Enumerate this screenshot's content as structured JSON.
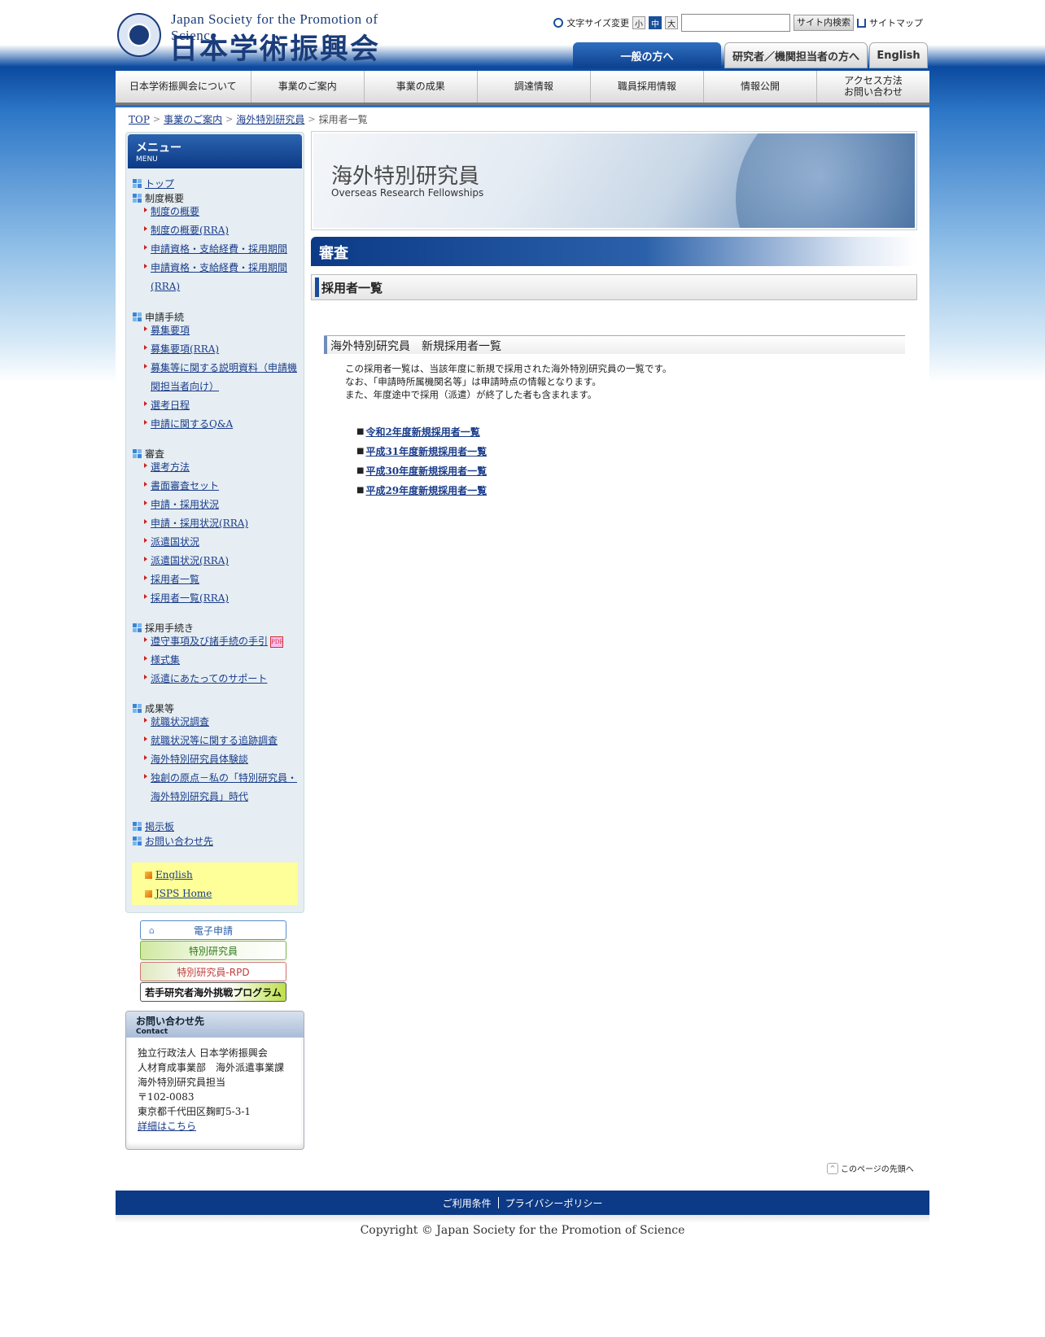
{
  "header": {
    "logo_en": "Japan Society for the Promotion of Science",
    "logo_jp": "日本学術振興会",
    "font_size_label": "文字サイズ変更",
    "font_sizes": [
      "小",
      "中",
      "大"
    ],
    "search_placeholder": "",
    "search_button": "サイト内検索",
    "sitemap": "サイトマップ",
    "tabs": [
      "一般の方へ",
      "研究者／機関担当者の方へ",
      "English"
    ]
  },
  "gnav": [
    "日本学術振興会について",
    "事業のご案内",
    "事業の成果",
    "調達情報",
    "職員採用情報",
    "情報公開",
    "アクセス方法\nお問い合わせ"
  ],
  "breadcrumb": [
    "TOP",
    "事業のご案内",
    "海外特別研究員",
    "採用者一覧"
  ],
  "sidebar": {
    "title": "メニュー",
    "title_en": "MENU",
    "top": "トップ",
    "sec1": "制度概要",
    "sec1_items": [
      "制度の概要",
      "制度の概要(RRA)",
      "申請資格・支給経費・採用期間",
      "申請資格・支給経費・採用期間(RRA)"
    ],
    "sec2": "申請手続",
    "sec2_items": [
      "募集要項",
      "募集要項(RRA)",
      "募集等に関する説明資料（申請機関担当者向け）",
      "選考日程",
      "申請に関するQ&A"
    ],
    "sec3": "審査",
    "sec3_items": [
      "選考方法",
      "書面審査セット",
      "申請・採用状況",
      "申請・採用状況(RRA)",
      "派遣国状況",
      "派遣国状況(RRA)",
      "採用者一覧",
      "採用者一覧(RRA)"
    ],
    "sec4": "採用手続き",
    "sec4_items": [
      "遵守事項及び諸手続の手引",
      "様式集",
      "派遣にあたってのサポート"
    ],
    "sec5": "成果等",
    "sec5_items": [
      "就職状況調査",
      "就職状況等に関する追跡調査",
      "海外特別研究員体験談",
      "独創の原点－私の「特別研究員・海外特別研究員」時代"
    ],
    "bbs": "掲示板",
    "contact": "お問い合わせ先",
    "links": [
      "English",
      "JSPS Home"
    ]
  },
  "banners": [
    "電子申請",
    "特別研究員",
    "特別研究員-RPD",
    "若手研究者海外挑戦プログラム"
  ],
  "contact": {
    "title": "お問い合わせ先",
    "title_en": "Contact",
    "lines": [
      "独立行政法人 日本学術振興会",
      "人材育成事業部　海外派遣事業課",
      "海外特別研究員担当",
      "〒102-0083",
      "東京都千代田区麹町5-3-1"
    ],
    "detail": "詳細はこちら"
  },
  "main": {
    "hero_jp": "海外特別研究員",
    "hero_en": "Overseas Research Fellowships",
    "h2": "審査",
    "h3": "採用者一覧",
    "h4": "海外特別研究員　新規採用者一覧",
    "desc": [
      "この採用者一覧は、当該年度に新規で採用された海外特別研究員の一覧です。",
      "なお、「申請時所属機関名等」は申請時点の情報となります。",
      "また、年度途中で採用（派遣）が終了した者も含まれます。"
    ],
    "bullet": "■",
    "links": [
      "令和2年度新規採用者一覧",
      "平成31年度新規採用者一覧",
      "平成30年度新規採用者一覧",
      "平成29年度新規採用者一覧"
    ]
  },
  "to_top": "このページの先頭へ",
  "footer": {
    "links": [
      "ご利用条件",
      "プライバシーポリシー"
    ],
    "copyright": "Copyright © Japan Society for the Promotion of Science"
  },
  "colors": {
    "brand_blue": "#0c3a86",
    "link": "#1a3c8a",
    "sidebar_bg": "#e6eef3",
    "highlight_yellow": "#ffff99"
  }
}
